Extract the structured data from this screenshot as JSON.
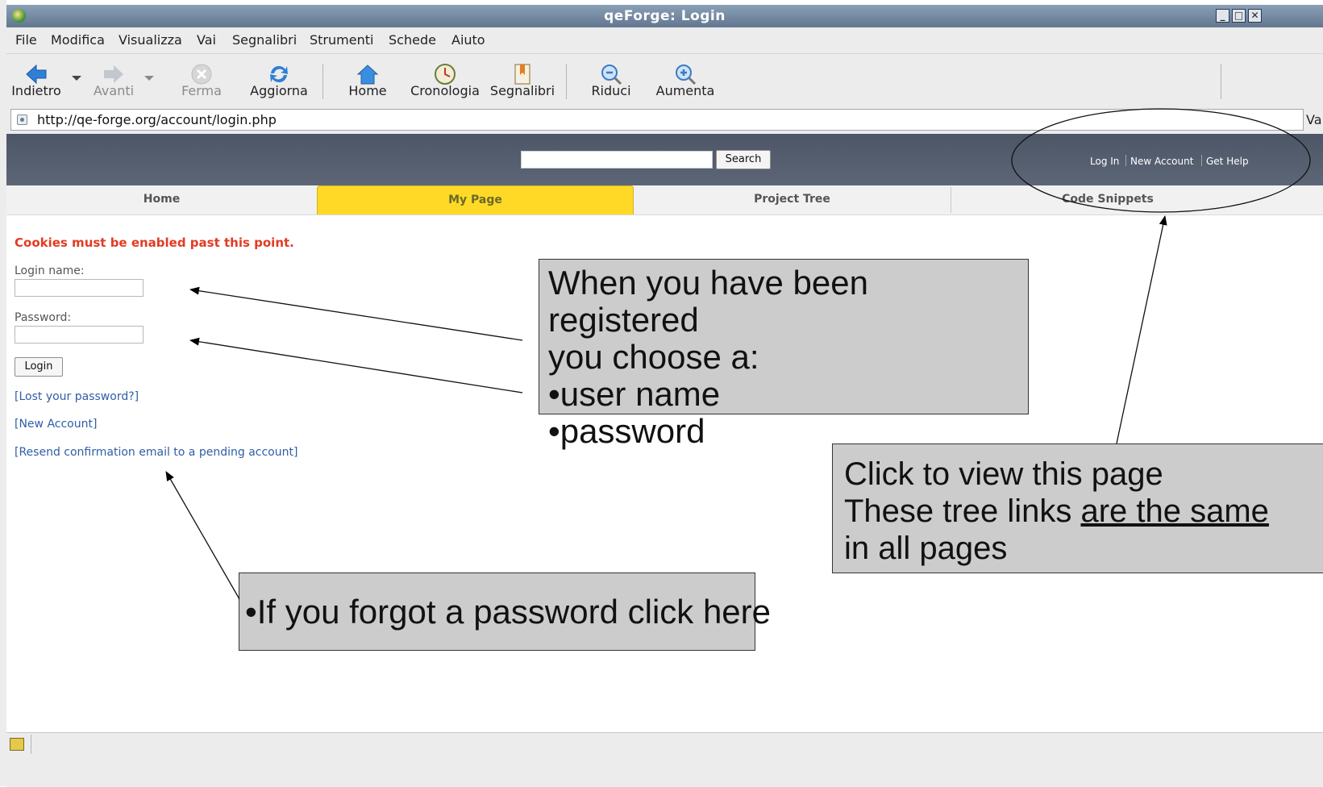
{
  "window": {
    "title": "qeForge: Login"
  },
  "menubar": [
    {
      "label": "File"
    },
    {
      "label": "Modifica"
    },
    {
      "label": "Visualizza"
    },
    {
      "label": "Vai"
    },
    {
      "label": "Segnalibri"
    },
    {
      "label": "Strumenti"
    },
    {
      "label": "Schede"
    },
    {
      "label": "Aiuto"
    }
  ],
  "toolbar": {
    "back": "Indietro",
    "forward": "Avanti",
    "stop": "Ferma",
    "reload": "Aggiorna",
    "home": "Home",
    "history": "Cronologia",
    "bookmarks": "Segnalibri",
    "zoom_out": "Riduci",
    "zoom_in": "Aumenta"
  },
  "address": {
    "url": "http://qe-forge.org/account/login.php",
    "go": "Vai"
  },
  "site_header": {
    "search_button": "Search",
    "links": [
      "Log In",
      "New Account",
      "Get Help"
    ]
  },
  "tabs": [
    {
      "label": "Home"
    },
    {
      "label": "My Page",
      "active": true
    },
    {
      "label": "Project Tree"
    },
    {
      "label": "Code Snippets"
    }
  ],
  "form": {
    "cookie_warning": "Cookies must be enabled past this point.",
    "login_label": "Login name:",
    "password_label": "Password:",
    "login_button": "Login",
    "links": [
      "[Lost your password?]",
      "[New Account]",
      "[Resend confirmation email to a pending account]"
    ]
  },
  "callouts": {
    "registered": {
      "line1": "When you have been registered",
      "line2": "you choose a:",
      "line3": "•user name",
      "line4": "•password"
    },
    "tree": {
      "line1": "Click to view this page",
      "line2_pre": "These tree links ",
      "line2_u": "are the same",
      "line3": "in all pages"
    },
    "forgot": {
      "text": "•If you forgot a password click here"
    }
  },
  "colors": {
    "title_bar": "#6f84a0",
    "site_header": "#525c6c",
    "active_tab": "#ffd926",
    "cookie_warning": "#e23b24",
    "link": "#2f5ea8",
    "callout_bg": "#cccccc"
  }
}
